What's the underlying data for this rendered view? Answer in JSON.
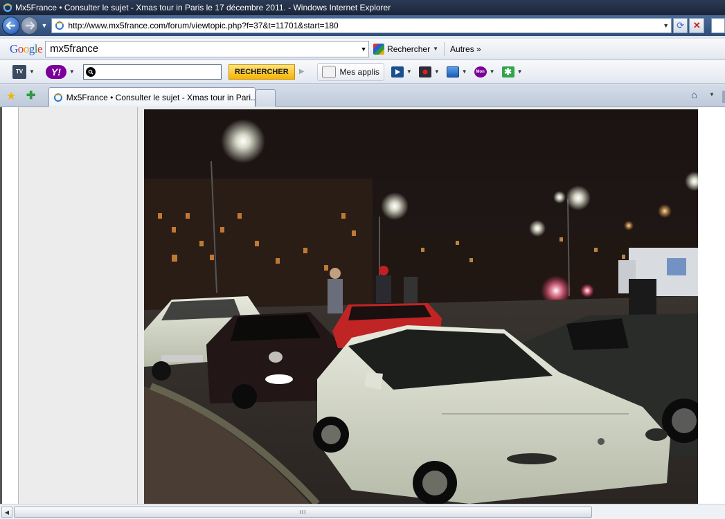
{
  "window": {
    "title": "Mx5France • Consulter le sujet - Xmas tour in Paris le 17 décembre 2011. - Windows Internet Explorer"
  },
  "address_bar": {
    "url": "http://www.mx5france.com/forum/viewtopic.php?f=37&t=11701&start=180"
  },
  "google_toolbar": {
    "logo": "Google",
    "search_value": "mx5france",
    "search_button": "Rechercher",
    "more_label": "Autres »"
  },
  "yahoo_toolbar": {
    "tv_label": "TV",
    "logo": "Y!",
    "search_button": "RECHERCHER",
    "apps_label": "Mes applis",
    "mon_label": "Mon"
  },
  "tabs": {
    "active_label": "Mx5France • Consulter le sujet - Xmas tour in Pari..."
  },
  "scrollbar": {
    "grip": "III"
  },
  "colors": {
    "titlebar": "#1a2538",
    "address_bar": "#2f4d78",
    "toolbar": "#e3e8f0",
    "search_button": "#f5b400",
    "content_bg": "#ececec"
  },
  "icons": {
    "ie": "ie-logo-icon",
    "back": "arrow-left-icon",
    "forward": "arrow-right-icon",
    "refresh": "refresh-icon",
    "stop": "close-icon",
    "favorites": "star-icon",
    "add_favorite": "add-star-icon",
    "home": "home-icon"
  }
}
